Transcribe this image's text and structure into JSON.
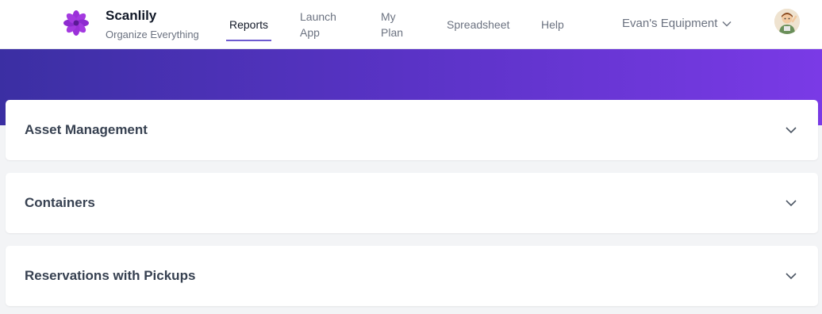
{
  "brand": {
    "name": "Scanlily",
    "tagline": "Organize Everything",
    "logo_icon": "flower-logo-icon"
  },
  "nav": {
    "items": [
      {
        "label": "Reports",
        "active": true
      },
      {
        "label_line1": "Launch",
        "label_line2": "App"
      },
      {
        "label_line1": "My",
        "label_line2": "Plan"
      },
      {
        "label": "Spreadsheet"
      },
      {
        "label": "Help"
      }
    ]
  },
  "account": {
    "name": "Evan's Equipment",
    "dropdown_icon": "chevron-down-icon",
    "avatar_icon": "user-avatar"
  },
  "colors": {
    "accent": "#6d5bd0",
    "banner_start": "#3b2fa3",
    "banner_end": "#7a3ae6"
  },
  "sections": [
    {
      "title": "Asset Management",
      "icon": "chevron-down-icon"
    },
    {
      "title": "Containers",
      "icon": "chevron-down-icon"
    },
    {
      "title": "Reservations with Pickups",
      "icon": "chevron-down-icon"
    }
  ]
}
